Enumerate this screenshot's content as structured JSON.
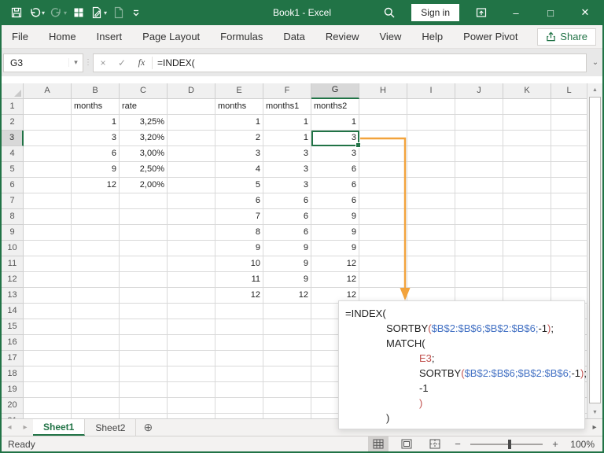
{
  "window": {
    "title": "Book1 - Excel",
    "titlebar": {
      "sign_in_label": "Sign in",
      "icons": [
        "save-icon",
        "undo-icon",
        "redo-icon",
        "grid-icon",
        "new-doc-edit-icon",
        "new-doc-icon",
        "customize-qat-icon",
        "search-icon",
        "ribbon-display-options-icon",
        "minimize-icon",
        "maximize-icon",
        "close-icon"
      ]
    },
    "accent_color": "#217346"
  },
  "ribbon": {
    "tabs": [
      "File",
      "Home",
      "Insert",
      "Page Layout",
      "Formulas",
      "Data",
      "Review",
      "View",
      "Help",
      "Power Pivot"
    ],
    "share_label": "Share"
  },
  "formula_bar": {
    "name_box_value": "G3",
    "formula_value": "=INDEX(",
    "cancel_glyph": "×",
    "enter_glyph": "✓",
    "fx_label": "fx"
  },
  "grid": {
    "column_headers": [
      "A",
      "B",
      "C",
      "D",
      "E",
      "F",
      "G",
      "H",
      "I",
      "J",
      "K",
      "L"
    ],
    "row_count": 21,
    "selected_cell": "G3",
    "selected_column": "G",
    "selected_row": 3,
    "rows": [
      {
        "r": 1,
        "cells": {
          "B": "months",
          "C": "rate",
          "E": "months",
          "F": "months1",
          "G": "months2"
        }
      },
      {
        "r": 2,
        "cells": {
          "B": "1",
          "C": "3,25%",
          "E": "1",
          "F": "1",
          "G": "1"
        }
      },
      {
        "r": 3,
        "cells": {
          "B": "3",
          "C": "3,20%",
          "E": "2",
          "F": "1",
          "G": "3"
        }
      },
      {
        "r": 4,
        "cells": {
          "B": "6",
          "C": "3,00%",
          "E": "3",
          "F": "3",
          "G": "3"
        }
      },
      {
        "r": 5,
        "cells": {
          "B": "9",
          "C": "2,50%",
          "E": "4",
          "F": "3",
          "G": "6"
        }
      },
      {
        "r": 6,
        "cells": {
          "B": "12",
          "C": "2,00%",
          "E": "5",
          "F": "3",
          "G": "6"
        }
      },
      {
        "r": 7,
        "cells": {
          "E": "6",
          "F": "6",
          "G": "6"
        }
      },
      {
        "r": 8,
        "cells": {
          "E": "7",
          "F": "6",
          "G": "9"
        }
      },
      {
        "r": 9,
        "cells": {
          "E": "8",
          "F": "6",
          "G": "9"
        }
      },
      {
        "r": 10,
        "cells": {
          "E": "9",
          "F": "9",
          "G": "9"
        }
      },
      {
        "r": 11,
        "cells": {
          "E": "10",
          "F": "9",
          "G": "12"
        }
      },
      {
        "r": 12,
        "cells": {
          "E": "11",
          "F": "9",
          "G": "12"
        }
      },
      {
        "r": 13,
        "cells": {
          "E": "12",
          "F": "12",
          "G": "12"
        }
      }
    ]
  },
  "callout": {
    "arrow_color": "#f2a33c",
    "colors": {
      "k": "#1f1f1f",
      "b": "#4472c4",
      "r": "#c0504d"
    },
    "lines": [
      {
        "indent": 0,
        "segments": [
          [
            "=INDEX(",
            "k"
          ]
        ]
      },
      {
        "indent": 1,
        "segments": [
          [
            "SORTBY",
            "k"
          ],
          [
            "(",
            "r"
          ],
          [
            "$B$2:$B$6;$B$2:$B$6;",
            "b"
          ],
          [
            "-1",
            "k"
          ],
          [
            ")",
            "r"
          ],
          [
            ";",
            "k"
          ]
        ]
      },
      {
        "indent": 1,
        "segments": [
          [
            "MATCH(",
            "k"
          ]
        ]
      },
      {
        "indent": 2,
        "segments": [
          [
            "E3",
            "r"
          ],
          [
            ";",
            "k"
          ]
        ]
      },
      {
        "indent": 2,
        "segments": [
          [
            "SORTBY",
            "k"
          ],
          [
            "(",
            "r"
          ],
          [
            "$B$2:$B$6;$B$2:$B$6;",
            "b"
          ],
          [
            "-1",
            "k"
          ],
          [
            ")",
            "r"
          ],
          [
            ";",
            "k"
          ]
        ]
      },
      {
        "indent": 2,
        "segments": [
          [
            "-1",
            "k"
          ]
        ]
      },
      {
        "indent": 2,
        "segments": [
          [
            ")",
            "r"
          ]
        ]
      },
      {
        "indent": 1,
        "segments": [
          [
            ")",
            "k"
          ]
        ]
      }
    ]
  },
  "sheet_tabs": {
    "tabs": [
      {
        "label": "Sheet1",
        "active": true
      },
      {
        "label": "Sheet2",
        "active": false
      }
    ],
    "new_sheet_glyph": "⊕"
  },
  "status_bar": {
    "status": "Ready",
    "view_icons": [
      "normal-view-icon",
      "page-layout-view-icon",
      "page-break-preview-icon"
    ],
    "zoom_level": "100%"
  }
}
